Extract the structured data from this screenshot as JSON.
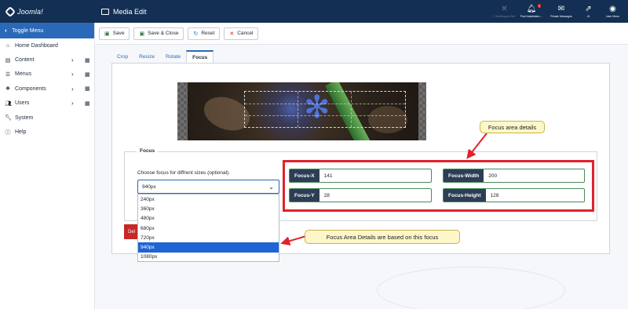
{
  "header": {
    "brand": "Joomla!",
    "page_title": "Media Edit",
    "items": [
      {
        "label": "0 Multilingual Site",
        "icon": "language-icon",
        "dim": true
      },
      {
        "label": "Post Installation ...",
        "icon": "bell-icon",
        "badge": "3"
      },
      {
        "label": "Private Messages",
        "icon": "envelope-icon"
      },
      {
        "label": "J4",
        "icon": "external-link-icon"
      },
      {
        "label": "User Menu",
        "icon": "user-circle-icon"
      }
    ]
  },
  "sidebar": {
    "toggle_label": "Toggle Menu",
    "items": [
      {
        "label": "Home Dashboard",
        "icon": "home-icon"
      },
      {
        "label": "Content",
        "icon": "file-icon",
        "has_children": true
      },
      {
        "label": "Menus",
        "icon": "list-icon",
        "has_children": true
      },
      {
        "label": "Components",
        "icon": "cubes-icon",
        "has_children": true
      },
      {
        "label": "Users",
        "icon": "users-icon",
        "has_children": true
      },
      {
        "label": "System",
        "icon": "wrench-icon"
      },
      {
        "label": "Help",
        "icon": "info-icon"
      }
    ]
  },
  "toolbar": {
    "save": "Save",
    "save_close": "Save & Close",
    "reset": "Reset",
    "cancel": "Cancel"
  },
  "tabs": [
    "Crop",
    "Resize",
    "Rotate",
    "Focus"
  ],
  "active_tab": "Focus",
  "focus": {
    "legend": "Focus",
    "choose_label": "Choose focus for diffrent sizes (optional).",
    "selected": "940px",
    "options": [
      "240px",
      "360px",
      "480px",
      "680px",
      "720px",
      "940px",
      "1080px"
    ],
    "delete_label": "Del",
    "fields": {
      "x_label": "Focus-X",
      "x_value": "141",
      "y_label": "Focus-Y",
      "y_value": "28",
      "width_label": "Focus-Width",
      "width_value": "200",
      "height_label": "Focus-Height",
      "height_value": "128"
    }
  },
  "callouts": {
    "area_details": "Focus area details",
    "based_on": "Focus Area Details are based on this focus"
  },
  "colors": {
    "header_bg": "#132f53",
    "accent": "#2a69b8",
    "highlight_border": "#e2212b",
    "callout_bg": "#fdf6c9",
    "selected_option": "#1e64d4"
  }
}
